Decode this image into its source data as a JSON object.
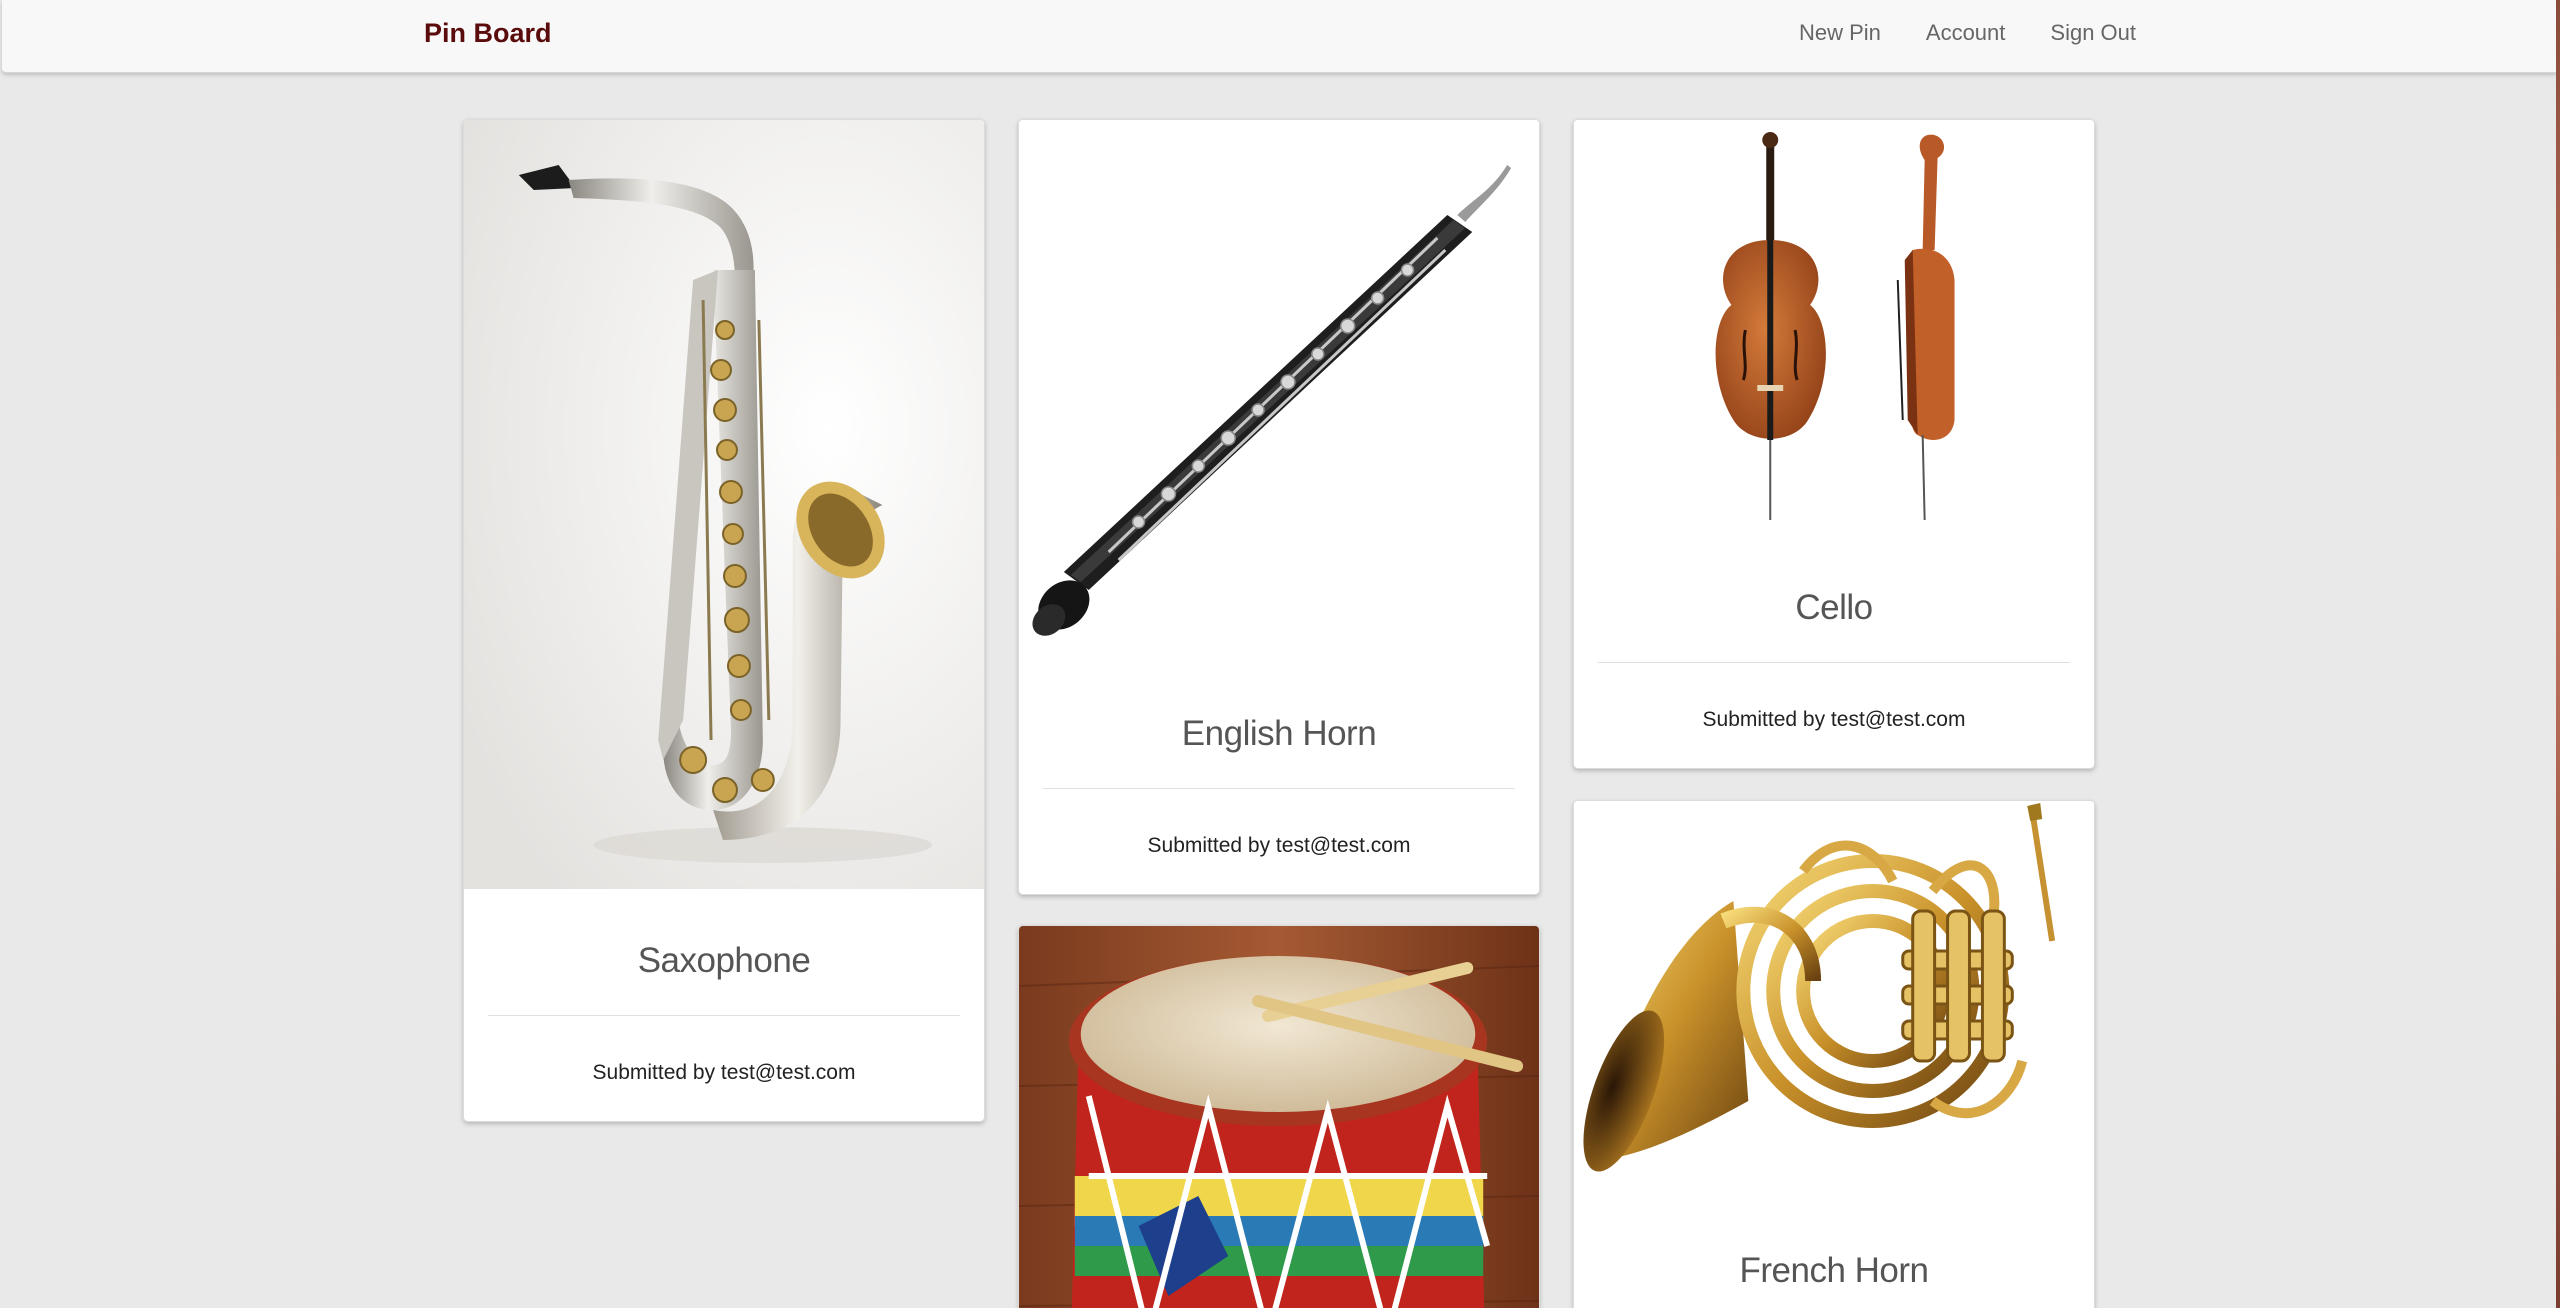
{
  "navbar": {
    "brand": "Pin Board",
    "links": [
      "New Pin",
      "Account",
      "Sign Out"
    ]
  },
  "pins": [
    {
      "title": "Saxophone",
      "submitted": "Submitted by test@test.com",
      "icon": "saxophone-image"
    },
    {
      "title": "English Horn",
      "submitted": "Submitted by test@test.com",
      "icon": "english-horn-image"
    },
    {
      "title": "",
      "submitted": "",
      "icon": "drum-image"
    },
    {
      "title": "Cello",
      "submitted": "Submitted by test@test.com",
      "icon": "cello-image"
    },
    {
      "title": "French Horn",
      "submitted": "",
      "icon": "french-horn-image"
    }
  ],
  "colors": {
    "brand": "#5a0c0c",
    "background": "#e9e9e9",
    "navbar": "#f8f8f8",
    "card": "#ffffff"
  }
}
